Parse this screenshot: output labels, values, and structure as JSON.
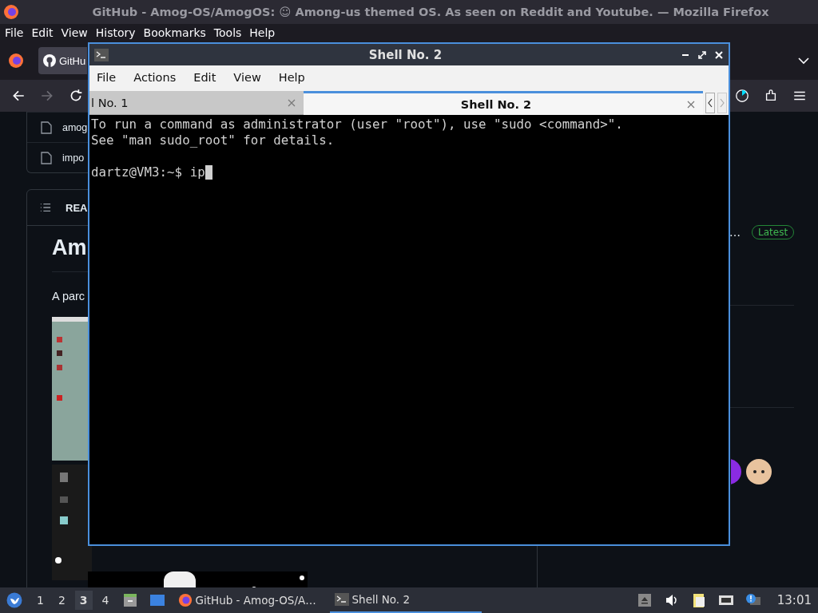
{
  "firefox": {
    "title": "GitHub - Amog-OS/AmogOS: ☺ Among-us themed OS. As seen on Reddit and Youtube. — Mozilla Firefox",
    "menu": [
      "File",
      "Edit",
      "View",
      "History",
      "Bookmarks",
      "Tools",
      "Help"
    ],
    "tab": {
      "label": "GitHu"
    },
    "page": {
      "files": [
        "amog",
        "impo"
      ],
      "readme_label": "REA",
      "heading": "Am",
      "paragraph": "A parc",
      "release_text": "…",
      "release_badge": "Latest"
    }
  },
  "terminal": {
    "title": "Shell No. 2",
    "menu": [
      "File",
      "Actions",
      "Edit",
      "View",
      "Help"
    ],
    "tabs": [
      {
        "label": "l No. 1",
        "selected": false
      },
      {
        "label": "Shell No. 2",
        "selected": true
      }
    ],
    "output": [
      "To run a command as administrator (user \"root\"), use \"sudo <command>\".",
      "See \"man sudo_root\" for details."
    ],
    "prompt": "dartz@VM3:~$",
    "input": "ip"
  },
  "taskbar": {
    "workspaces": [
      {
        "label": "1",
        "selected": false
      },
      {
        "label": "2",
        "selected": false
      },
      {
        "label": "3",
        "selected": true
      },
      {
        "label": "4",
        "selected": false
      }
    ],
    "tasks": [
      {
        "label": "GitHub - Amog-OS/A…",
        "kind": "browser",
        "selected": false
      },
      {
        "label": "Shell No. 2",
        "kind": "terminal",
        "selected": true
      }
    ],
    "clock": "13:01"
  }
}
